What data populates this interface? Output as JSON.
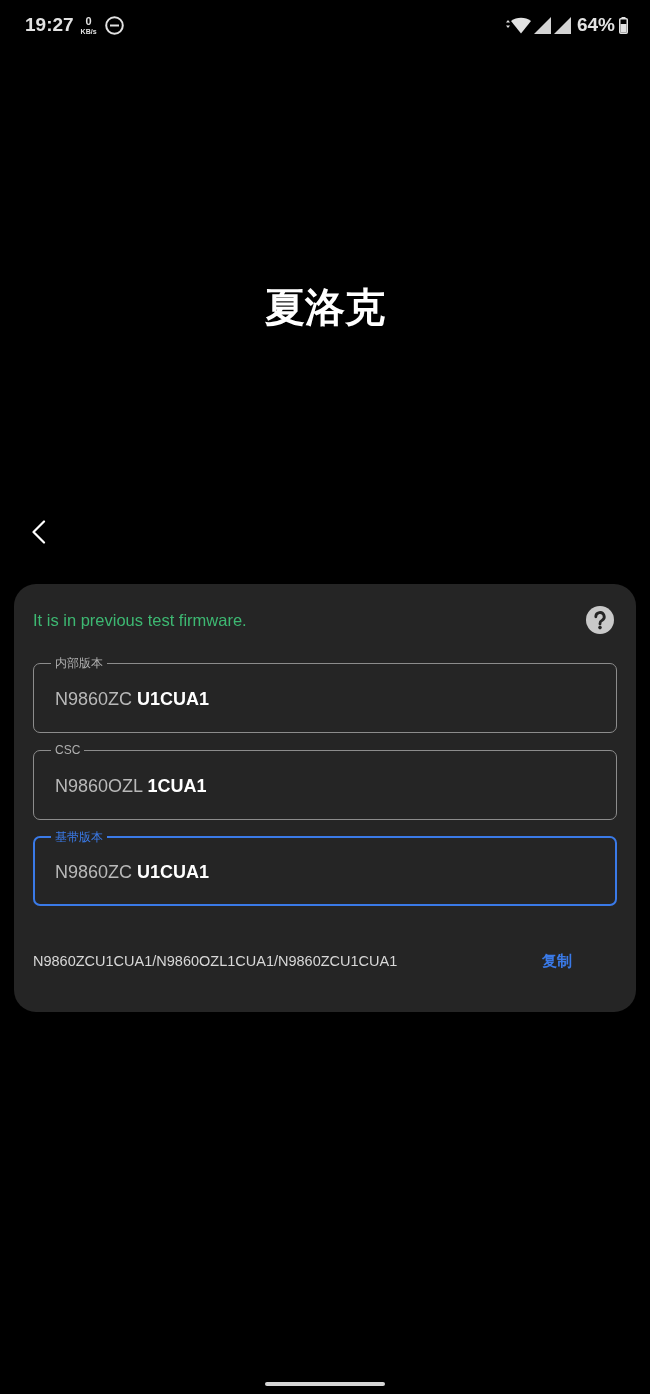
{
  "status_bar": {
    "time": "19:27",
    "net_speed": "0",
    "net_speed_unit": "KB/s",
    "battery": "64%"
  },
  "title": "夏洛克",
  "card": {
    "message": "It is in previous test firmware.",
    "fields": [
      {
        "label": "内部版本",
        "value": "N9860ZC **U1CUA1**",
        "focused": false
      },
      {
        "label": "CSC",
        "value": "N9860OZL **1CUA1**",
        "focused": false
      },
      {
        "label": "基带版本",
        "value": "N9860ZC **U1CUA1**",
        "focused": true
      }
    ],
    "summary": "N9860ZCU1CUA1/N9860OZL1CUA1/N9860ZCU1CUA1",
    "copy_button": "复制"
  }
}
